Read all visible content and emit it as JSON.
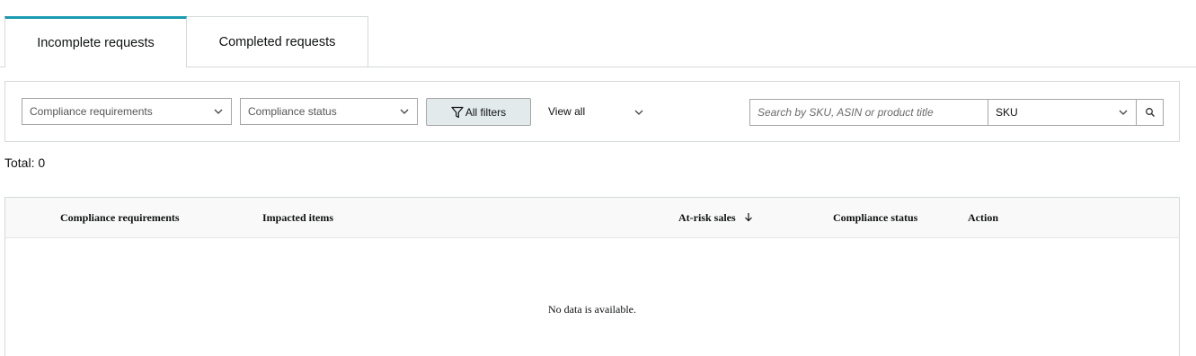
{
  "tabs": [
    {
      "label": "Incomplete requests",
      "active": true
    },
    {
      "label": "Completed requests",
      "active": false
    }
  ],
  "filters": {
    "compliance_requirements": "Compliance requirements",
    "compliance_status": "Compliance status",
    "all_filters": "All filters",
    "view_all": "View all",
    "search_placeholder": "Search by SKU, ASIN or product title",
    "search_type": "SKU"
  },
  "total_label": "Total: 0",
  "table": {
    "columns": [
      "Compliance requirements",
      "Impacted items",
      "At-risk sales",
      "Compliance status",
      "Action"
    ],
    "sorted_column": "At-risk sales",
    "sort_direction": "descending",
    "empty_message": "No data is available."
  },
  "colors": {
    "active_tab_accent": "#1b9bb0",
    "filter_button_bg": "#e3eaec"
  }
}
